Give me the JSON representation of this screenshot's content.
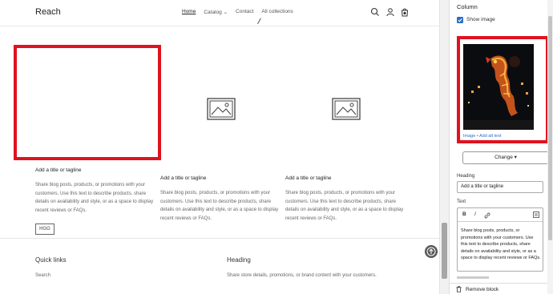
{
  "store": {
    "name": "Reach",
    "nav": [
      {
        "label": "Home",
        "active": true
      },
      {
        "label": "Catalog",
        "has_dropdown": true
      },
      {
        "label": "Contact"
      },
      {
        "label": "All collections"
      }
    ]
  },
  "columns": [
    {
      "title": "Add a title or tagline",
      "text": "Share blog posts, products, or promotions with your customers. Use this text to describe products, share details on availability and style, or as a space to display recent reviews or FAQs.",
      "button": "HGG",
      "image": "empty-selected"
    },
    {
      "title": "Add a title or tagline",
      "text": "Share blog posts, products, or promotions with your customers. Use this text to describe products, share details on availability and style, or as a space to display recent reviews or FAQs.",
      "image": "placeholder"
    },
    {
      "title": "Add a title or tagline",
      "text": "Share blog posts, products, or promotions with your customers. Use this text to describe products, share details on availability and style, or as a space to display recent reviews or FAQs.",
      "image": "placeholder"
    }
  ],
  "footer": {
    "quick_links": "Quick links",
    "search": "Search",
    "heading": "Heading",
    "text": "Share store details, promotions, or brand content with your customers."
  },
  "panel": {
    "title": "Column",
    "show_image": "Show image",
    "show_image_checked": true,
    "image_links": "Image • Add alt text",
    "change_button": "Change",
    "heading_label": "Heading",
    "heading_value": "Add a title or tagline",
    "text_label": "Text",
    "toolbar": {
      "bold": "B",
      "italic": "I",
      "link": "🔗"
    },
    "text_value": "Share blog posts, products, or promotions with your customers. Use this text to describe products, share details on availability and style, or as a space to display recent reviews or FAQs.",
    "remove_block": "Remove block"
  },
  "colors": {
    "highlight": "#e0121f",
    "accent": "#2c6ecb"
  }
}
